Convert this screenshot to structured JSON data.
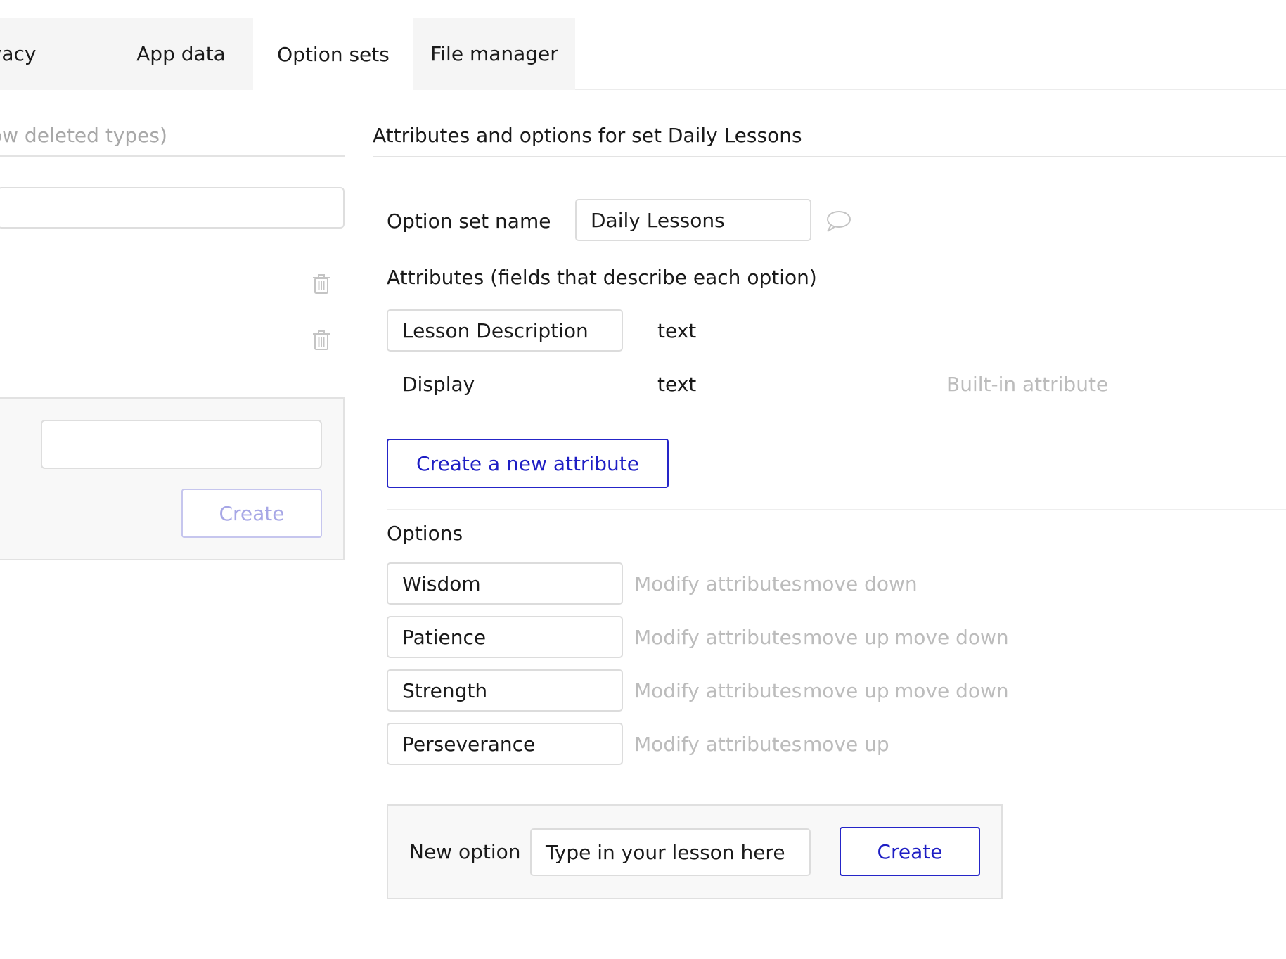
{
  "tabs": [
    {
      "label": "ivacy",
      "active": false
    },
    {
      "label": "App data",
      "active": false
    },
    {
      "label": "Option sets",
      "active": true
    },
    {
      "label": "File manager",
      "active": false
    }
  ],
  "left": {
    "hint": "ow deleted types)",
    "search_value": "",
    "new_set_value": "",
    "create_label": "Create"
  },
  "panel": {
    "title": "Attributes and options for set Daily Lessons",
    "name_label": "Option set name",
    "name_value": "Daily Lessons",
    "attributes_heading": "Attributes (fields that describe each option)",
    "attributes": [
      {
        "name": "Lesson Description",
        "type": "text",
        "note": ""
      },
      {
        "name": "Display",
        "type": "text",
        "note": "Built-in attribute"
      }
    ],
    "create_attribute_label": "Create a new attribute",
    "options_heading": "Options",
    "options": [
      {
        "name": "Wisdom",
        "modify": "Modify attributes",
        "move_up": "",
        "move_down": "move down"
      },
      {
        "name": "Patience",
        "modify": "Modify attributes",
        "move_up": "move up",
        "move_down": "move down"
      },
      {
        "name": "Strength",
        "modify": "Modify attributes",
        "move_up": "move up",
        "move_down": "move down"
      },
      {
        "name": "Perseverance",
        "modify": "Modify attributes",
        "move_up": "move up",
        "move_down": ""
      }
    ],
    "new_option": {
      "label": "New option",
      "placeholder": "Type in your lesson here",
      "create_label": "Create"
    }
  },
  "colors": {
    "accent": "#1e1ec4",
    "muted_text": "#bcbcbc",
    "tab_inactive_bg": "#f5f5f5"
  }
}
